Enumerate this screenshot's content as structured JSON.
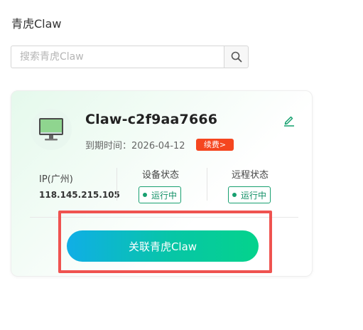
{
  "page": {
    "title": "青虎Claw"
  },
  "search": {
    "placeholder": "搜索青虎Claw"
  },
  "card": {
    "name": "Claw-c2f9aa7666",
    "expiry_label": "到期时间：",
    "expiry_date": "2026-04-12",
    "renew_label": "续费>",
    "ip_label": "IP(广州)",
    "ip_value": "118.145.215.105",
    "device_status_label": "设备状态",
    "device_status_value": "运行中",
    "remote_status_label": "远程状态",
    "remote_status_value": "运行中",
    "link_button_label": "关联青虎Claw"
  },
  "colors": {
    "accent_green": "#18a070",
    "renew_red": "#f5461f",
    "highlight_red": "#ef5350",
    "button_gradient_start": "#10aee6",
    "button_gradient_end": "#04d38c"
  },
  "icons": {
    "search": "search-icon",
    "computer": "computer-monitor-icon",
    "edit": "edit-pencil-icon"
  }
}
